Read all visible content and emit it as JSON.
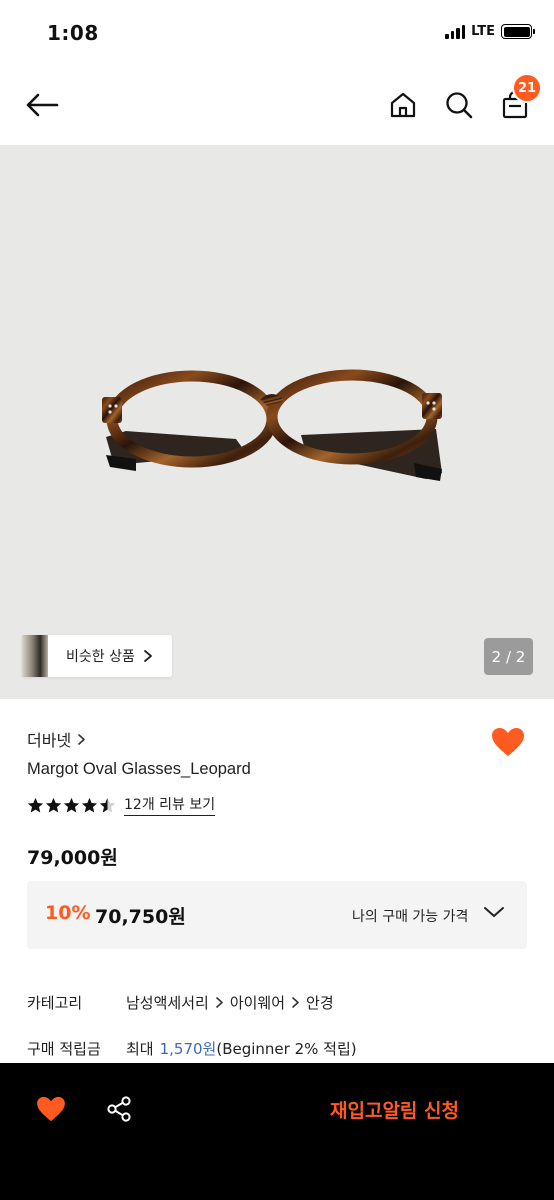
{
  "status_bar": {
    "time": "1:08",
    "network": "LTE"
  },
  "nav": {
    "cart_count": "21"
  },
  "image": {
    "counter": "2 / 2",
    "similar_label": "비슷한 상품"
  },
  "product": {
    "brand": "더바넷",
    "name": "Margot Oval Glasses_Leopard",
    "rating": 4.5,
    "review_link": "12개 리뷰 보기",
    "price": "79,000원",
    "discount_rate": "10%",
    "discount_price": "70,750원",
    "my_price_label": "나의 구매 가능 가격"
  },
  "category": {
    "label": "카테고리",
    "path": [
      "남성액세서리",
      "아이웨어",
      "안경"
    ]
  },
  "points": {
    "label": "구매 적립금",
    "prefix": "최대",
    "amount": "1,570원",
    "suffix": "(Beginner 2% 적립)"
  },
  "bottom_bar": {
    "restock_label": "재입고알림 신청"
  },
  "colors": {
    "accent": "#ff5a1f",
    "points": "#3c6ab8",
    "image_bg": "#e8e8e6",
    "bottom_bar": "#000000"
  }
}
